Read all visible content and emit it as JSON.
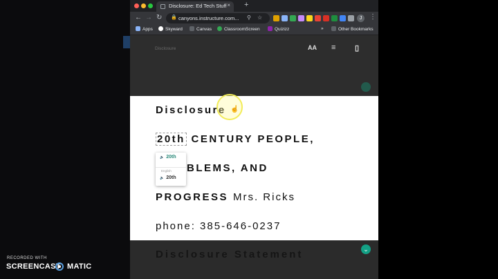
{
  "tab": {
    "title": "Disclosure: Ed Tech Stuff",
    "close": "×",
    "new_tab": "+"
  },
  "nav": {
    "back": "←",
    "forward": "→",
    "reload": "↻"
  },
  "omnibox": {
    "lock": "🔒",
    "url": "canyons.instructure.com...",
    "search": "⚲",
    "star": "☆"
  },
  "profile": {
    "initial": "J"
  },
  "menu": {
    "kebab": "⋮"
  },
  "bookmarks": {
    "items": [
      "Apps",
      "Skyward",
      "Canvas",
      "ClassroomScreen",
      "Quizizz"
    ],
    "overflow": "»",
    "other": "Other Bookmarks"
  },
  "viewer": {
    "title": "Disclosure",
    "text_size_icon": "AA",
    "preferences_icon": "≡",
    "reader_icon": "▯"
  },
  "document": {
    "heading": "Disclosure",
    "word_20th": "20th",
    "line1_rest": "CENTURY PEOPLE,",
    "line2": "BLEMS, AND",
    "line3_bold": "PROGRESS",
    "line3_normal": "Mrs. Ricks",
    "phone": "phone: 385-646-0237"
  },
  "lookup": {
    "primary": "20th",
    "language": "English",
    "secondary": "20th",
    "speaker": "🔈"
  },
  "bottom": {
    "heading": "Disclosure Statement",
    "button_icon": "⌄"
  },
  "watermark": {
    "recorded": "RECORDED WITH",
    "brand_left": "SCREENCAST",
    "brand_right": "MATIC"
  },
  "colors": {
    "accent": "#13a085",
    "lookup_text": "#2b8a7a",
    "highlight": "#f2ec5a"
  }
}
